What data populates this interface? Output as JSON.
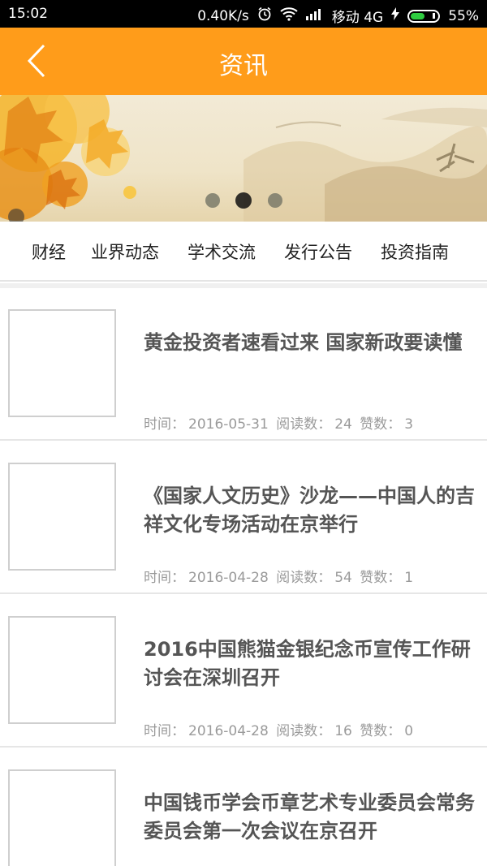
{
  "status_bar": {
    "time": "15:02",
    "speed": "0.40K/s",
    "carrier": "移动 4G",
    "battery": "55%",
    "battery_level": 0.55
  },
  "header": {
    "title": "资讯",
    "back_icon": "chevron-left-icon",
    "background": "#ff9c1a"
  },
  "banner": {
    "slides": 3,
    "active_slide": 2
  },
  "tabs": [
    {
      "label": "财经"
    },
    {
      "label": "业界动态"
    },
    {
      "label": "学术交流"
    },
    {
      "label": "发行公告"
    },
    {
      "label": "投资指南"
    }
  ],
  "news": [
    {
      "title": "黄金投资者速看过来 国家新政要读懂",
      "time_label": "时间：",
      "date": "2016-05-31",
      "reads_label": "阅读数：",
      "reads": "24",
      "likes_label": "赞数：",
      "likes": "3"
    },
    {
      "title": "《国家人文历史》沙龙——中国人的吉祥文化专场活动在京举行",
      "time_label": "时间：",
      "date": "2016-04-28",
      "reads_label": "阅读数：",
      "reads": "54",
      "likes_label": "赞数：",
      "likes": "1"
    },
    {
      "title": "2016中国熊猫金银纪念币宣传工作研讨会在深圳召开",
      "time_label": "时间：",
      "date": "2016-04-28",
      "reads_label": "阅读数：",
      "reads": "16",
      "likes_label": "赞数：",
      "likes": "0"
    },
    {
      "title": "中国钱币学会币章艺术专业委员会常务委员会第一次会议在京召开"
    }
  ]
}
